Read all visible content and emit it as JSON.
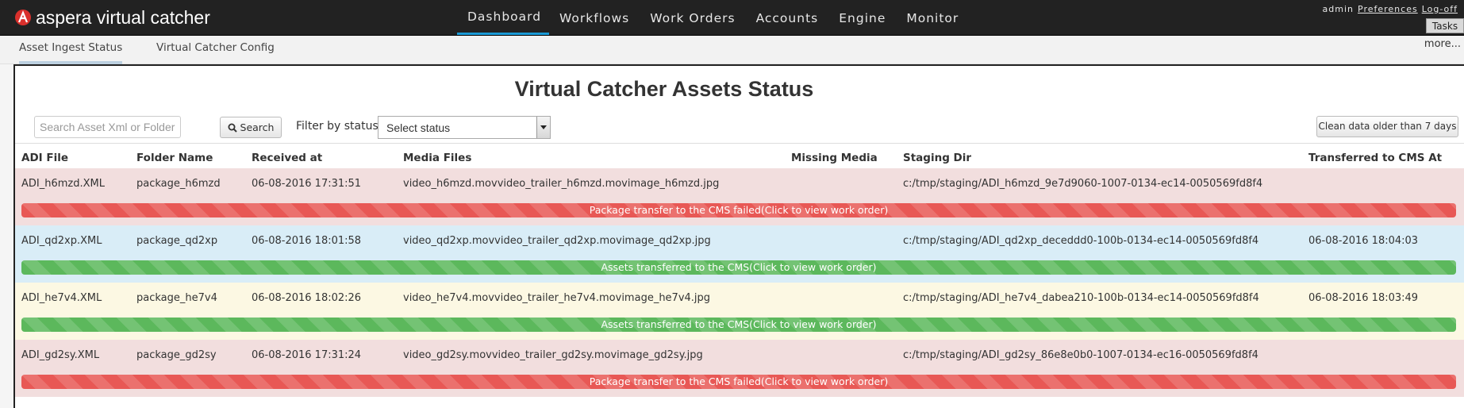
{
  "app": {
    "brand_name": "aspera virtual catcher",
    "brand_icon": "aspera-logo-icon"
  },
  "nav": {
    "items": [
      {
        "label": "Dashboard",
        "active": true
      },
      {
        "label": "Workflows"
      },
      {
        "label": "Work Orders"
      },
      {
        "label": "Accounts"
      },
      {
        "label": "Engine"
      },
      {
        "label": "Monitor"
      }
    ]
  },
  "user": {
    "name": "admin",
    "preferences": "Preferences",
    "logoff": "Log-off",
    "tasks": "Tasks"
  },
  "subnav": {
    "items": [
      {
        "label": "Asset Ingest Status",
        "active": true
      },
      {
        "label": "Virtual Catcher Config"
      }
    ],
    "more": "more..."
  },
  "page": {
    "title": "Virtual Catcher Assets Status",
    "search_placeholder": "Search Asset Xml or Folder name",
    "search_button": "Search",
    "filter_label": "Filter by status:",
    "filter_value": "Select status",
    "clean_button": "Clean data older than 7 days"
  },
  "table": {
    "columns": [
      "ADI File",
      "Folder Name",
      "Received at",
      "Media Files",
      "Missing Media",
      "Staging Dir",
      "Transferred to CMS At"
    ],
    "rows": [
      {
        "adi": "ADI_h6mzd.XML",
        "folder": "package_h6mzd",
        "received": "06-08-2016 17:31:51",
        "media": "video_h6mzd.movvideo_trailer_h6mzd.movimage_h6mzd.jpg",
        "missing": "",
        "staging": "c:/tmp/staging/ADI_h6mzd_9e7d9060-1007-0134-ec14-0050569fd8f4",
        "transferred": "",
        "status": "Package transfer to the CMS failed(Click to view work order)",
        "state": "failed",
        "row_color": "#f2dede"
      },
      {
        "adi": "ADI_qd2xp.XML",
        "folder": "package_qd2xp",
        "received": "06-08-2016 18:01:58",
        "media": "video_qd2xp.movvideo_trailer_qd2xp.movimage_qd2xp.jpg",
        "missing": "",
        "staging": "c:/tmp/staging/ADI_qd2xp_deceddd0-100b-0134-ec14-0050569fd8f4",
        "transferred": "06-08-2016 18:04:03",
        "status": "Assets transferred to the CMS(Click to view work order)",
        "state": "ok",
        "row_color": "#d9edf7"
      },
      {
        "adi": "ADI_he7v4.XML",
        "folder": "package_he7v4",
        "received": "06-08-2016 18:02:26",
        "media": "video_he7v4.movvideo_trailer_he7v4.movimage_he7v4.jpg",
        "missing": "",
        "staging": "c:/tmp/staging/ADI_he7v4_dabea210-100b-0134-ec14-0050569fd8f4",
        "transferred": "06-08-2016 18:03:49",
        "status": "Assets transferred to the CMS(Click to view work order)",
        "state": "ok",
        "row_color": "#fcf8e3"
      },
      {
        "adi": "ADI_gd2sy.XML",
        "folder": "package_gd2sy",
        "received": "06-08-2016 17:31:24",
        "media": "video_gd2sy.movvideo_trailer_gd2sy.movimage_gd2sy.jpg",
        "missing": "",
        "staging": "c:/tmp/staging/ADI_gd2sy_86e8e0b0-1007-0134-ec16-0050569fd8f4",
        "transferred": "",
        "status": "Package transfer to the CMS failed(Click to view work order)",
        "state": "failed",
        "row_color": "#f2dede"
      }
    ]
  },
  "colors": {
    "navbar": "#222222",
    "active_tab": "#1a9ad6",
    "failed": "#e85855",
    "success": "#5cb85c"
  }
}
